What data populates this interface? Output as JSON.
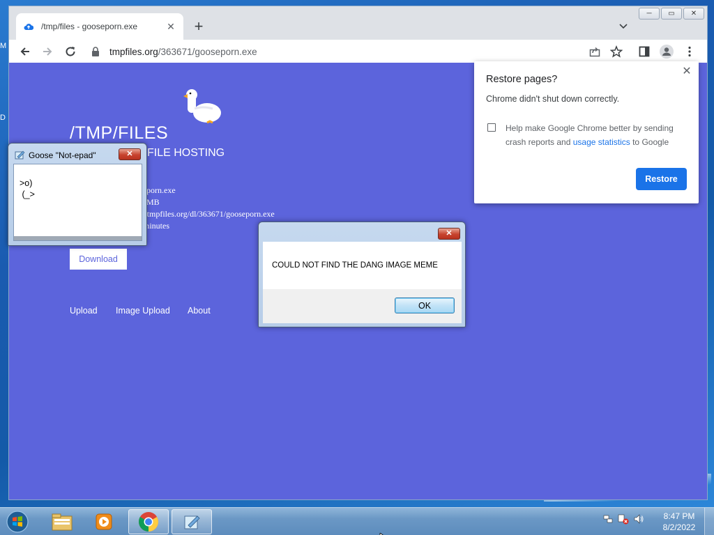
{
  "desktop": {
    "edge_letters": [
      "M",
      "D"
    ]
  },
  "browser": {
    "tab_title": "/tmp/files - gooseporn.exe",
    "url_host": "tmpfiles.org",
    "url_path": "/363671/gooseporn.exe",
    "new_tab_glyph": "+",
    "window_buttons": [
      "─",
      "▭",
      "✕"
    ]
  },
  "page": {
    "site_title": "/TMP/FILES",
    "site_subtitle": "FILE HOSTING",
    "info_lines": [
      "porn.exe",
      "MB",
      "//tmpfiles.org/dl/363671/gooseporn.exe",
      "minutes"
    ],
    "download_label": "Download",
    "nav": [
      "Upload",
      "Image Upload",
      "About"
    ],
    "colors": {
      "background": "#5c64dc"
    }
  },
  "restore_bubble": {
    "title": "Restore pages?",
    "message": "Chrome didn't shut down correctly.",
    "help_prefix": "Help make Google Chrome better by sending crash reports and ",
    "help_link": "usage statistics",
    "help_suffix": " to Google",
    "button": "Restore",
    "checked": false
  },
  "notepad": {
    "title": "Goose \"Not-epad\"",
    "content": ">o)\n (_>"
  },
  "message_box": {
    "text": "COULD NOT FIND THE DANG IMAGE MEME",
    "ok_label": "OK"
  },
  "taskbar": {
    "time": "8:47 PM",
    "date": "8/2/2022",
    "apps": [
      "explorer-icon",
      "media-player-icon",
      "chrome-icon",
      "notepad-icon"
    ]
  }
}
